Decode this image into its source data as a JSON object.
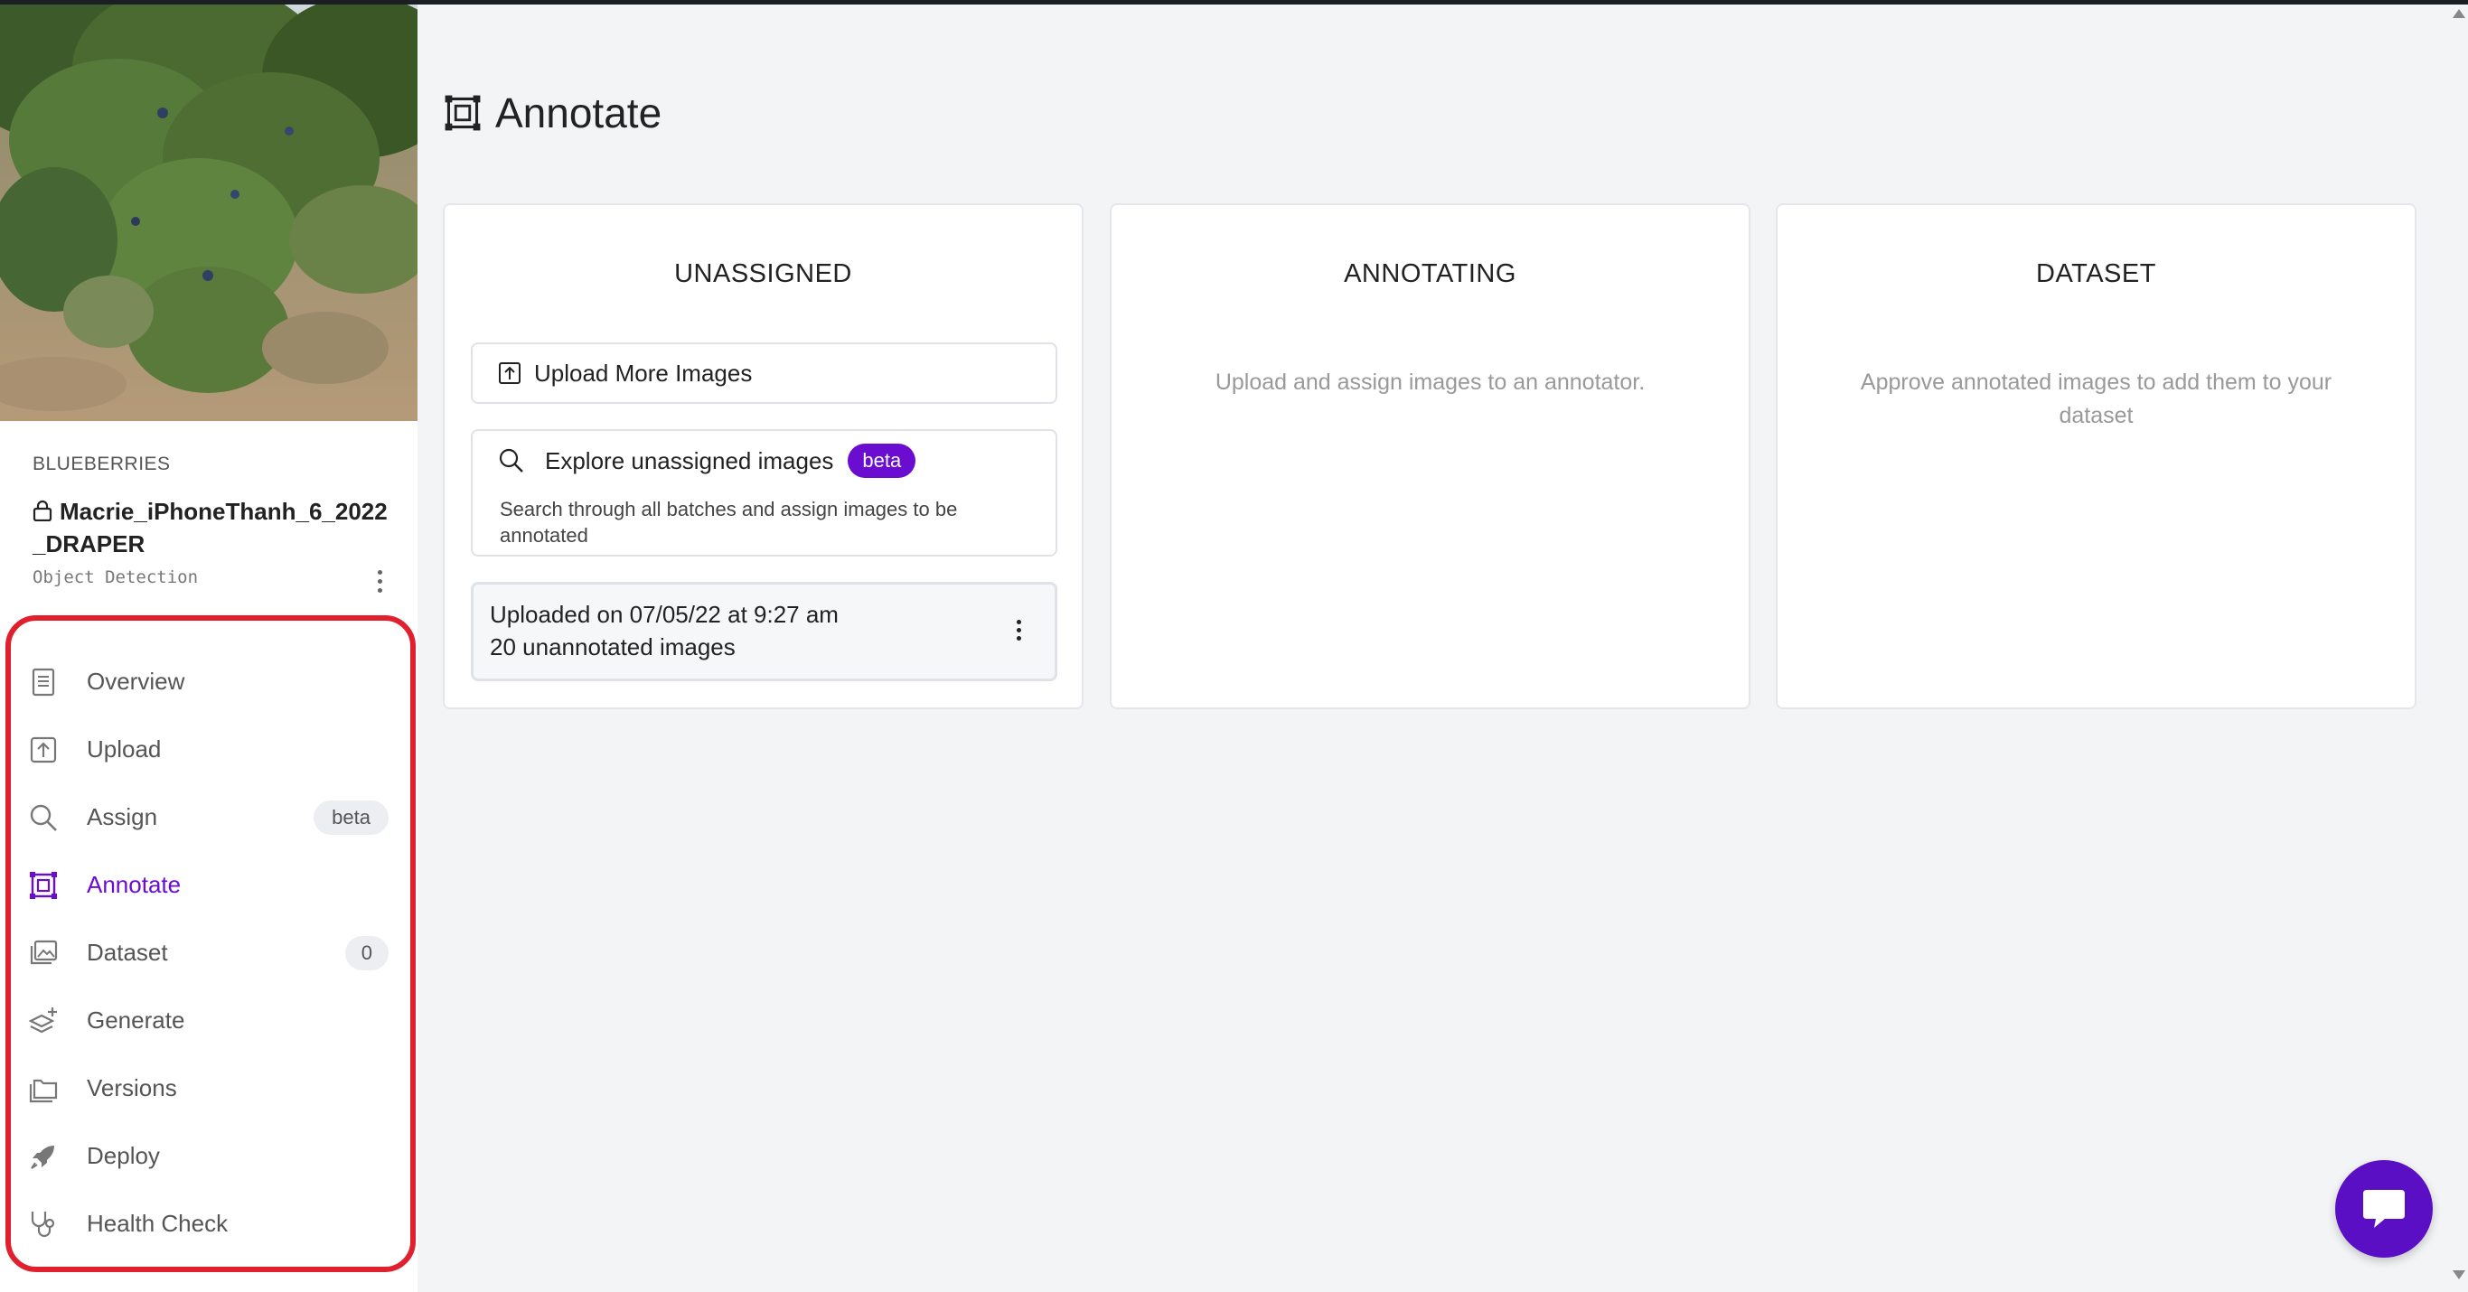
{
  "project": {
    "workspace": "BLUEBERRIES",
    "name": "Macrie_iPhoneThanh_6_2022_DRAPER",
    "type": "Object Detection"
  },
  "nav": {
    "items": [
      {
        "label": "Overview",
        "icon": "document-icon"
      },
      {
        "label": "Upload",
        "icon": "upload-icon"
      },
      {
        "label": "Assign",
        "icon": "search-icon",
        "badge": "beta"
      },
      {
        "label": "Annotate",
        "icon": "annotate-icon",
        "active": true
      },
      {
        "label": "Dataset",
        "icon": "images-icon",
        "badge": "0"
      },
      {
        "label": "Generate",
        "icon": "layers-plus-icon"
      },
      {
        "label": "Versions",
        "icon": "folders-icon"
      },
      {
        "label": "Deploy",
        "icon": "rocket-icon"
      },
      {
        "label": "Health Check",
        "icon": "stethoscope-icon"
      }
    ]
  },
  "page": {
    "title": "Annotate"
  },
  "columns": {
    "unassigned": {
      "title": "UNASSIGNED",
      "upload_button": "Upload More Images",
      "explore": {
        "title": "Explore unassigned images",
        "badge": "beta",
        "description": "Search through all batches and assign images to be annotated"
      },
      "batch": {
        "uploaded": "Uploaded on 07/05/22 at 9:27 am",
        "count": "20 unannotated images"
      }
    },
    "annotating": {
      "title": "ANNOTATING",
      "empty": "Upload and assign images to an annotator."
    },
    "dataset": {
      "title": "DATASET",
      "empty": "Approve annotated images to add them to your dataset"
    }
  },
  "colors": {
    "accent": "#6a0dd0",
    "chat_button": "#5b0fc4",
    "highlight_border": "#e0202c",
    "background": "#f3f4f6"
  }
}
